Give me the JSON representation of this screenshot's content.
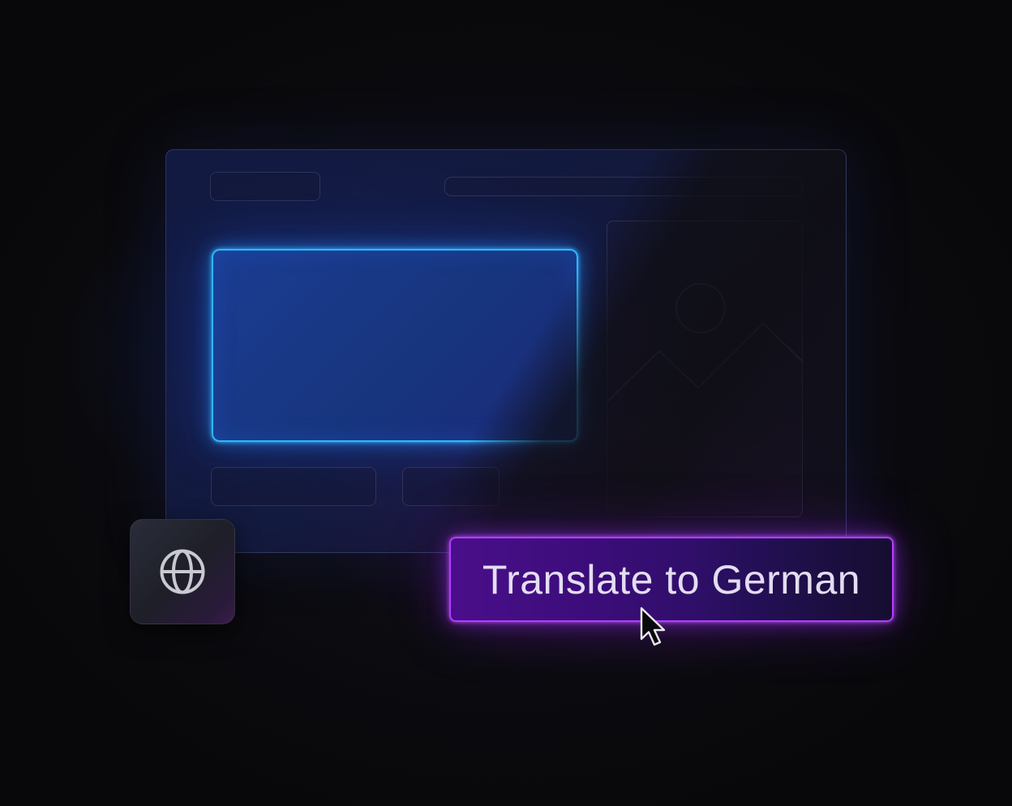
{
  "scene": {
    "title": ""
  },
  "window": {
    "has_logo_placeholder": true,
    "has_address_bar": true
  },
  "content": {
    "highlighted_block_color": "#2bb8ff",
    "image_placeholder_icon": "image-icon"
  },
  "globe_tile": {
    "icon": "globe-icon"
  },
  "translate_button": {
    "label": "Translate to German",
    "accent_color": "#b43cff"
  },
  "cursor": {
    "icon": "mouse-pointer-icon"
  }
}
